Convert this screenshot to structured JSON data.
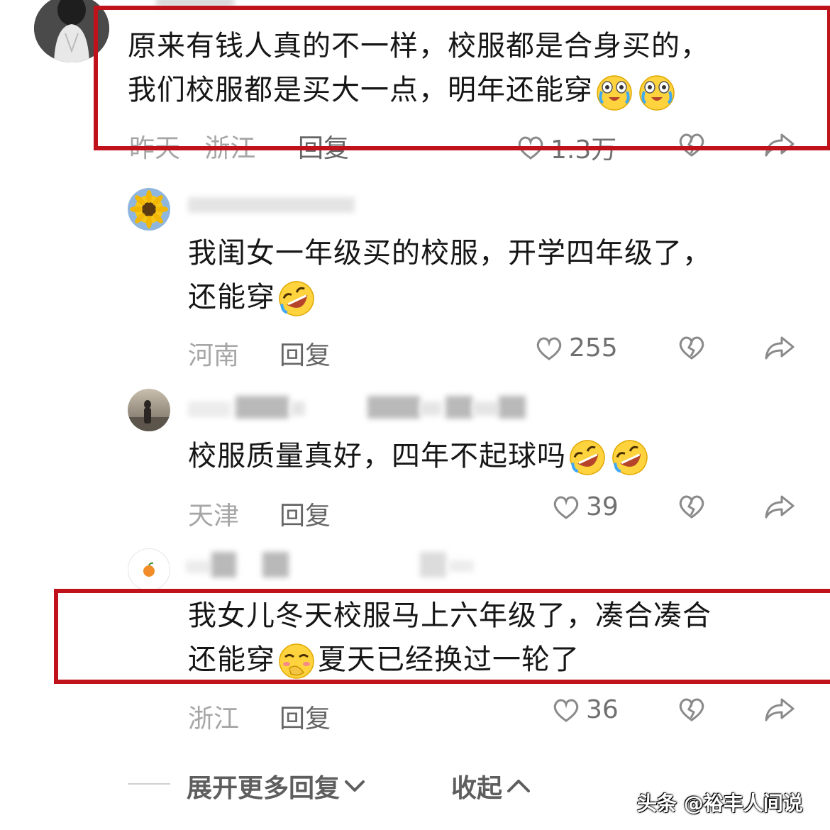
{
  "comments": [
    {
      "username": "",
      "text_line1": "原来有钱人真的不一样，校服都是合身买的，",
      "text_line2": "我们校服都是买大一点，明年还能穿",
      "location": "昨天 · 浙江",
      "reply_label": "回复",
      "likes": "1.3万"
    },
    {
      "username": "",
      "text_line1": "我闺女一年级买的校服，开学四年级了，",
      "text_line2": "还能穿",
      "location": "河南",
      "reply_label": "回复",
      "likes": "255"
    },
    {
      "username": "",
      "text_line1": "校服质量真好，四年不起球吗",
      "location": "天津",
      "reply_label": "回复",
      "likes": "39"
    },
    {
      "username": "",
      "text_line1": "我女儿冬天校服马上六年级了，凑合凑合",
      "text_line2a": "还能穿",
      "text_line2b": "夏天已经换过一轮了",
      "location": "浙江",
      "reply_label": "回复",
      "likes": "36"
    }
  ],
  "footer": {
    "expand_label": "展开更多回复",
    "collapse_label": "收起"
  },
  "watermark": "头条 @裕丰人间说",
  "colors": {
    "highlight_box": "#c0121b",
    "secondary_text": "#a6a6a6",
    "icon_gray": "#8a8a8a"
  }
}
